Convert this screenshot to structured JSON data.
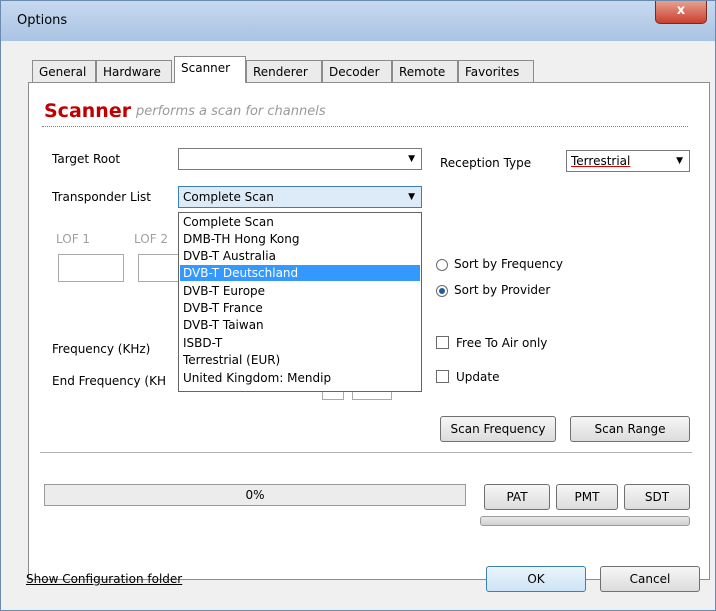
{
  "window": {
    "title": "Options",
    "close_glyph": "x"
  },
  "tabs": [
    {
      "label": "General"
    },
    {
      "label": "Hardware"
    },
    {
      "label": "Scanner"
    },
    {
      "label": "Renderer"
    },
    {
      "label": "Decoder"
    },
    {
      "label": "Remote"
    },
    {
      "label": "Favorites"
    }
  ],
  "header": {
    "title": "Scanner",
    "subtitle": "performs a scan for channels"
  },
  "target_root": {
    "label": "Target Root",
    "value": ""
  },
  "reception": {
    "label": "Reception Type",
    "value": "Terrestrial"
  },
  "transponder": {
    "label": "Transponder List",
    "value": "Complete Scan",
    "options": [
      "Complete Scan",
      "DMB-TH Hong Kong",
      "DVB-T Australia",
      "DVB-T Deutschland",
      "DVB-T Europe",
      "DVB-T France",
      "DVB-T Taiwan",
      "ISBD-T",
      "Terrestrial (EUR)",
      "United Kingdom: Mendip"
    ],
    "highlighted": "DVB-T Deutschland"
  },
  "lof": {
    "lof1": "LOF 1",
    "lof2": "LOF 2"
  },
  "sort": {
    "by_frequency": "Sort by Frequency",
    "by_provider": "Sort by Provider",
    "selected": "Sort by Provider"
  },
  "frequency_label": "Frequency (KHz)",
  "end_frequency_label": "End  Frequency (KH",
  "free_to_air": {
    "label": "Free To Air only",
    "checked": false
  },
  "update": {
    "label": "Update",
    "checked": false
  },
  "buttons": {
    "scan_frequency": "Scan Frequency",
    "scan_range": "Scan Range",
    "pat": "PAT",
    "pmt": "PMT",
    "sdt": "SDT",
    "ok": "OK",
    "cancel": "Cancel"
  },
  "progress": {
    "text": "0%",
    "value": 0
  },
  "footer": {
    "link": "Show Configuration folder"
  },
  "colors": {
    "accent": "#c00000",
    "selection": "#3399ff"
  }
}
